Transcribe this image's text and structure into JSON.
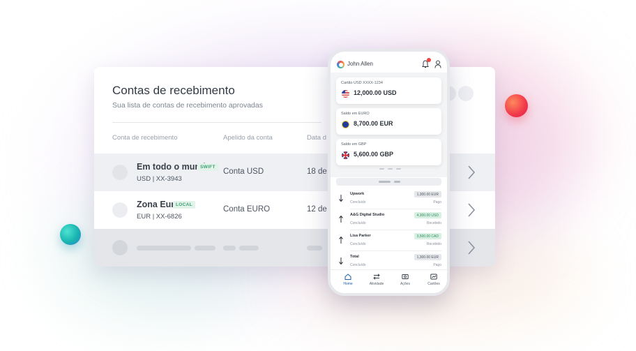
{
  "colors": {
    "accent": "#1e5fa8",
    "badge_green": "#3f9f73"
  },
  "desktop": {
    "title": "Contas de recebimento",
    "subtitle": "Sua lista de contas de recebimento aprovadas",
    "columns": [
      "Conta de recebimento",
      "Apelido da conta",
      "Data d"
    ],
    "rows": [
      {
        "name": "Em todo o mundo",
        "badge": "SWIFT",
        "sub": "USD | XX-3943",
        "alias": "Conta USD",
        "date": "18 de"
      },
      {
        "name": "Zona Euro",
        "badge": "LOCAL",
        "sub": "EUR | XX-6826",
        "alias": "Conta EURO",
        "date": "12 de"
      }
    ]
  },
  "phone": {
    "user": "John Allen",
    "balances": [
      {
        "label": "Cartão USD XXXX-1234",
        "amount": "12,000.00 USD",
        "flag": "us-flag-icon"
      },
      {
        "label": "Saldo em EURO",
        "amount": "8,700.00 EUR",
        "flag": "eu-flag-icon"
      },
      {
        "label": "Saldo em GBP",
        "amount": "5,600.00 GBP",
        "flag": "gb-flag-icon"
      }
    ],
    "transactions": [
      {
        "name": "Upwork",
        "status": "Concluído",
        "amount": "1,300.00 EUR",
        "label": "Pago",
        "direction": "down"
      },
      {
        "name": "A&G Digital Studio",
        "status": "Concluído",
        "amount": "4,300.00 USD",
        "label": "Recebido",
        "direction": "up"
      },
      {
        "name": "Lisa Parker",
        "status": "Concluído",
        "amount": "3,500.00 CAD",
        "label": "Recebido",
        "direction": "up"
      },
      {
        "name": "Total",
        "status": "Concluído",
        "amount": "1,300.00 EUR",
        "label": "Pago",
        "direction": "down"
      }
    ],
    "nav": [
      "Home",
      "Atividade",
      "Ações",
      "Cartões"
    ]
  }
}
